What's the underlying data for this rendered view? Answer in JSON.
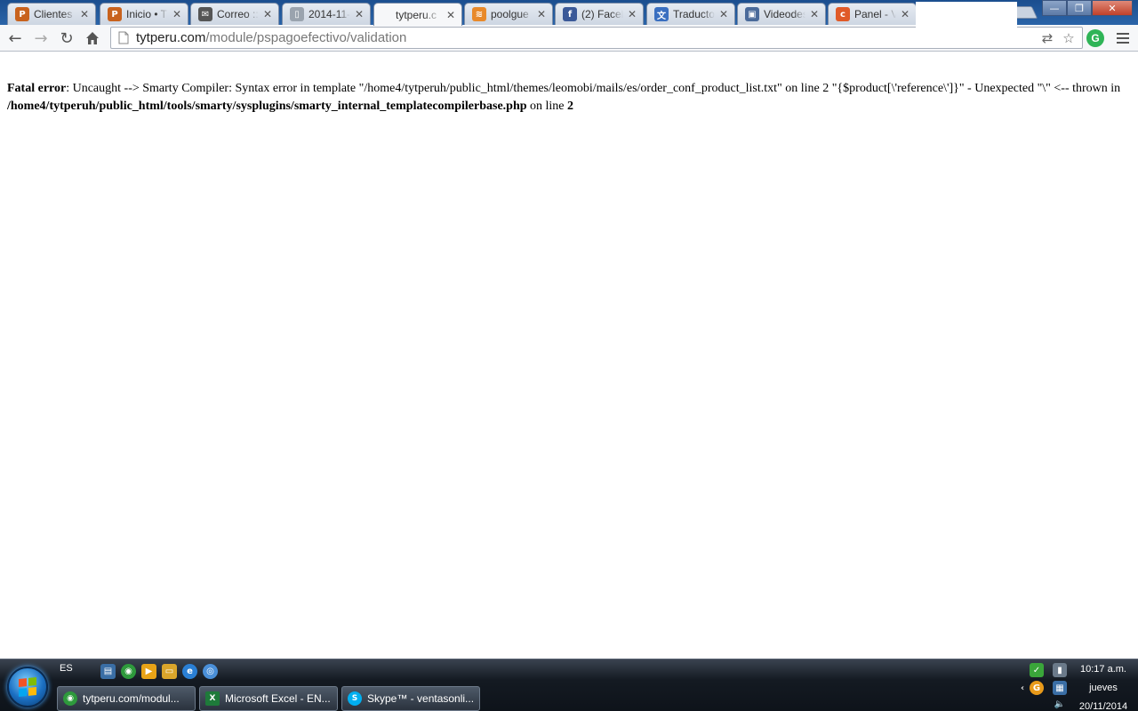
{
  "browser": {
    "tabs": [
      {
        "title": "Clientes",
        "favicon": "prestashop-icon",
        "icon_color": "#c8621d",
        "icon_char": "P"
      },
      {
        "title": "Inicio • T",
        "favicon": "prestashop-icon",
        "icon_color": "#c8621d",
        "icon_char": "P"
      },
      {
        "title": "Correo ::",
        "favicon": "mail-icon",
        "icon_color": "#555555",
        "icon_char": "✉"
      },
      {
        "title": "2014-11-",
        "favicon": "document-icon",
        "icon_color": "#9aa3ae",
        "icon_char": "▯"
      },
      {
        "title": "tytperu.c",
        "favicon": "none",
        "icon_color": "",
        "icon_char": "",
        "active": true
      },
      {
        "title": "poolgue",
        "favicon": "rss-icon",
        "icon_color": "#e8892a",
        "icon_char": "≋"
      },
      {
        "title": "(2) Faceb",
        "favicon": "facebook-icon",
        "icon_color": "#3b5998",
        "icon_char": "f"
      },
      {
        "title": "Traducto",
        "favicon": "translate-icon",
        "icon_color": "#3a6fc0",
        "icon_char": "文"
      },
      {
        "title": "Videodes",
        "favicon": "video-icon",
        "icon_color": "#4a6a9a",
        "icon_char": "▣"
      },
      {
        "title": "Panel - V",
        "favicon": "cpanel-icon",
        "icon_color": "#e05a28",
        "icon_char": "c"
      }
    ],
    "close_glyph": "✕",
    "window_controls": {
      "minimize": "—",
      "maximize": "❐",
      "close": "✕"
    },
    "url_host": "tytperu.com",
    "url_path": "/module/pspagoefectivo/validation",
    "ext_letter": "G"
  },
  "page": {
    "error_label": "Fatal error",
    "message_part1": ": Uncaught --> Smarty Compiler: Syntax error in template \"/home4/tytperuh/public_html/themes/leomobi/mails/es/order_conf_product_list.txt\" on line 2 \"{$product[\\'reference\\']}\" - Unexpected \"\\\" <-- thrown in ",
    "file_path": "/home4/tytperuh/public_html/tools/smarty/sysplugins/smarty_internal_templatecompilerbase.php",
    "message_part2": " on line ",
    "line_number": "2"
  },
  "taskbar": {
    "language": "ES",
    "buttons": [
      {
        "label": "tytperu.com/modul...",
        "icon_color": "#2e9a3c",
        "icon_char": "◉"
      },
      {
        "label": "Microsoft Excel - EN...",
        "icon_color": "#1e7a3a",
        "icon_char": "X"
      },
      {
        "label": "Skype™ - ventasonli...",
        "icon_color": "#00aff0",
        "icon_char": "S"
      }
    ],
    "time": "10:17 a.m.",
    "day": "jueves",
    "date": "20/11/2014"
  }
}
